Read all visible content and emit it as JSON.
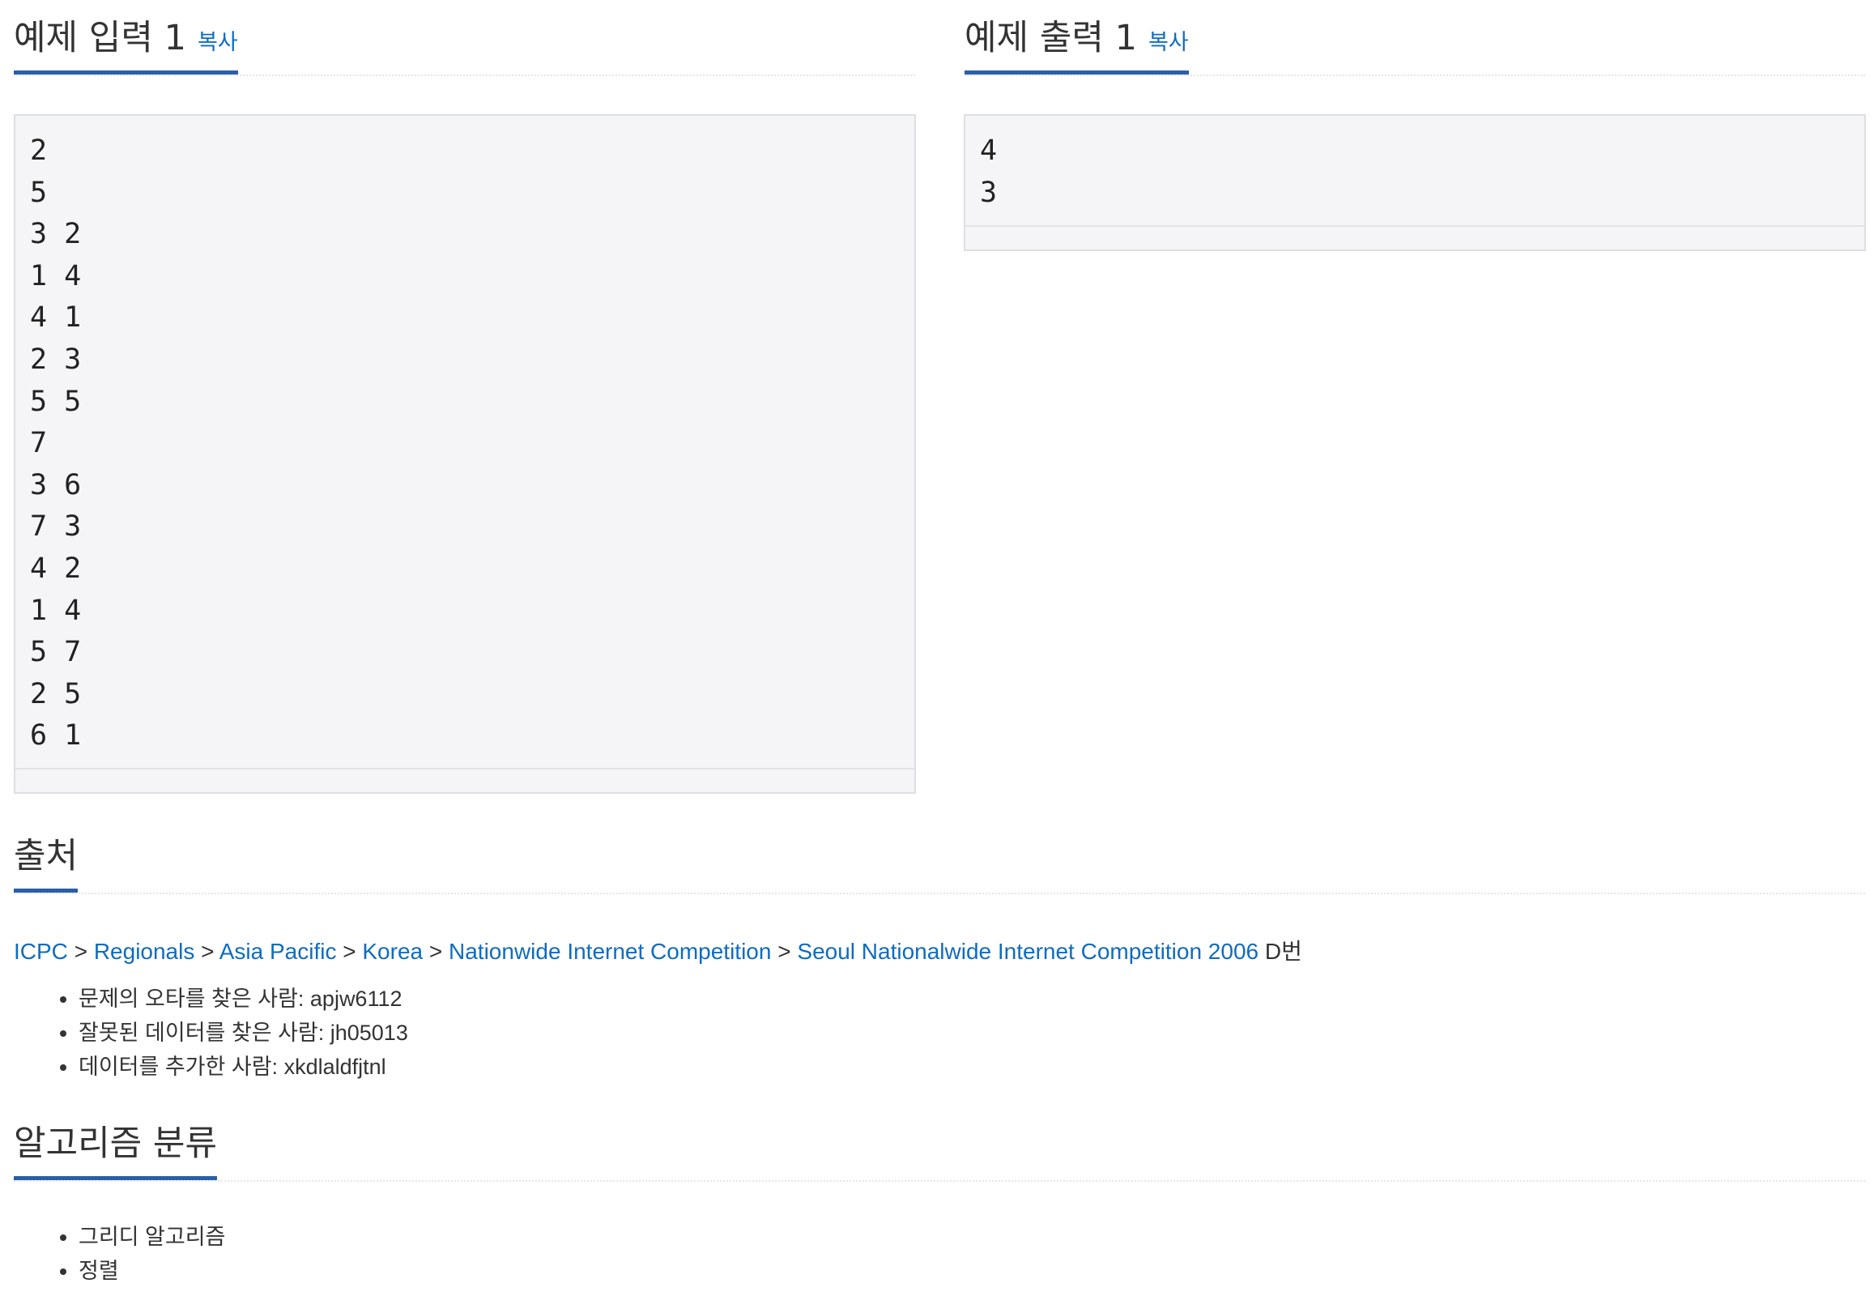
{
  "sample_input": {
    "title": "예제 입력 1",
    "copy_label": "복사",
    "content": "2\n5\n3 2\n1 4\n4 1\n2 3\n5 5\n7\n3 6\n7 3\n4 2\n1 4\n5 7\n2 5\n6 1"
  },
  "sample_output": {
    "title": "예제 출력 1",
    "copy_label": "복사",
    "content": "4\n3"
  },
  "source": {
    "title": "출처",
    "breadcrumb": [
      "ICPC",
      "Regionals",
      "Asia Pacific",
      "Korea",
      "Nationwide Internet Competition",
      "Seoul Nationalwide Internet Competition 2006"
    ],
    "separator": ">",
    "suffix": "D번",
    "contributors": [
      "문제의 오타를 찾은 사람: apjw6112",
      "잘못된 데이터를 찾은 사람: jh05013",
      "데이터를 추가한 사람: xkdlaldfjtnl"
    ]
  },
  "algorithm": {
    "title": "알고리즘 분류",
    "tags": [
      "그리디 알고리즘",
      "정렬"
    ]
  },
  "colors": {
    "accent": "#2a5fa8",
    "link": "#0e6cc0",
    "text": "#333333",
    "box_bg": "#f5f5f7"
  }
}
